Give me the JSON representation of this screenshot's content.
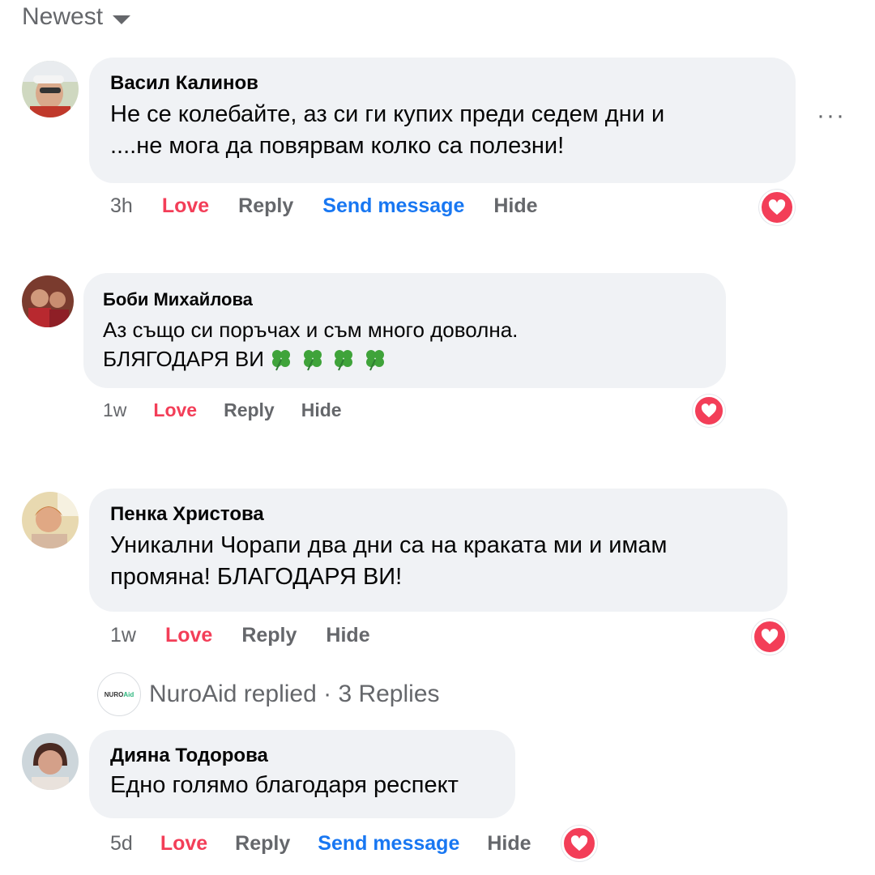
{
  "sort": {
    "label": "Newest"
  },
  "comments": [
    {
      "author": "Васил Калинов",
      "lines": [
        "Не се колебайте, аз си ги купих преди седем дни и",
        "....не мога да повярвам колко са полезни!"
      ],
      "time": "3h",
      "love": "Love",
      "reply": "Reply",
      "send": "Send message",
      "hide": "Hide"
    },
    {
      "author": "Боби Михайлова",
      "lines": [
        "Аз също си поръчах и съм много доволна.",
        "БЛЯГОДАРЯ ВИ"
      ],
      "time": "1w",
      "love": "Love",
      "reply": "Reply",
      "hide": "Hide"
    },
    {
      "author": "Пенка Христова",
      "lines": [
        "Уникални Чорапи два дни са на краката ми и имам",
        "промяна! БЛАГОДАРЯ ВИ!"
      ],
      "time": "1w",
      "love": "Love",
      "reply": "Reply",
      "hide": "Hide"
    },
    {
      "author": "Дияна Тодорова",
      "lines": [
        "Едно голямо благодаря респект"
      ],
      "time": "5d",
      "love": "Love",
      "reply": "Reply",
      "send": "Send message",
      "hide": "Hide"
    }
  ],
  "replies_summary": {
    "logo_text_1": "NURO",
    "logo_text_2": "Aid",
    "text": "NuroAid replied · 3 Replies"
  },
  "more_icon": "···",
  "colors": {
    "love": "#f33e58",
    "link": "#1877f2",
    "muted": "#65676b",
    "bubble": "#f0f2f5"
  }
}
